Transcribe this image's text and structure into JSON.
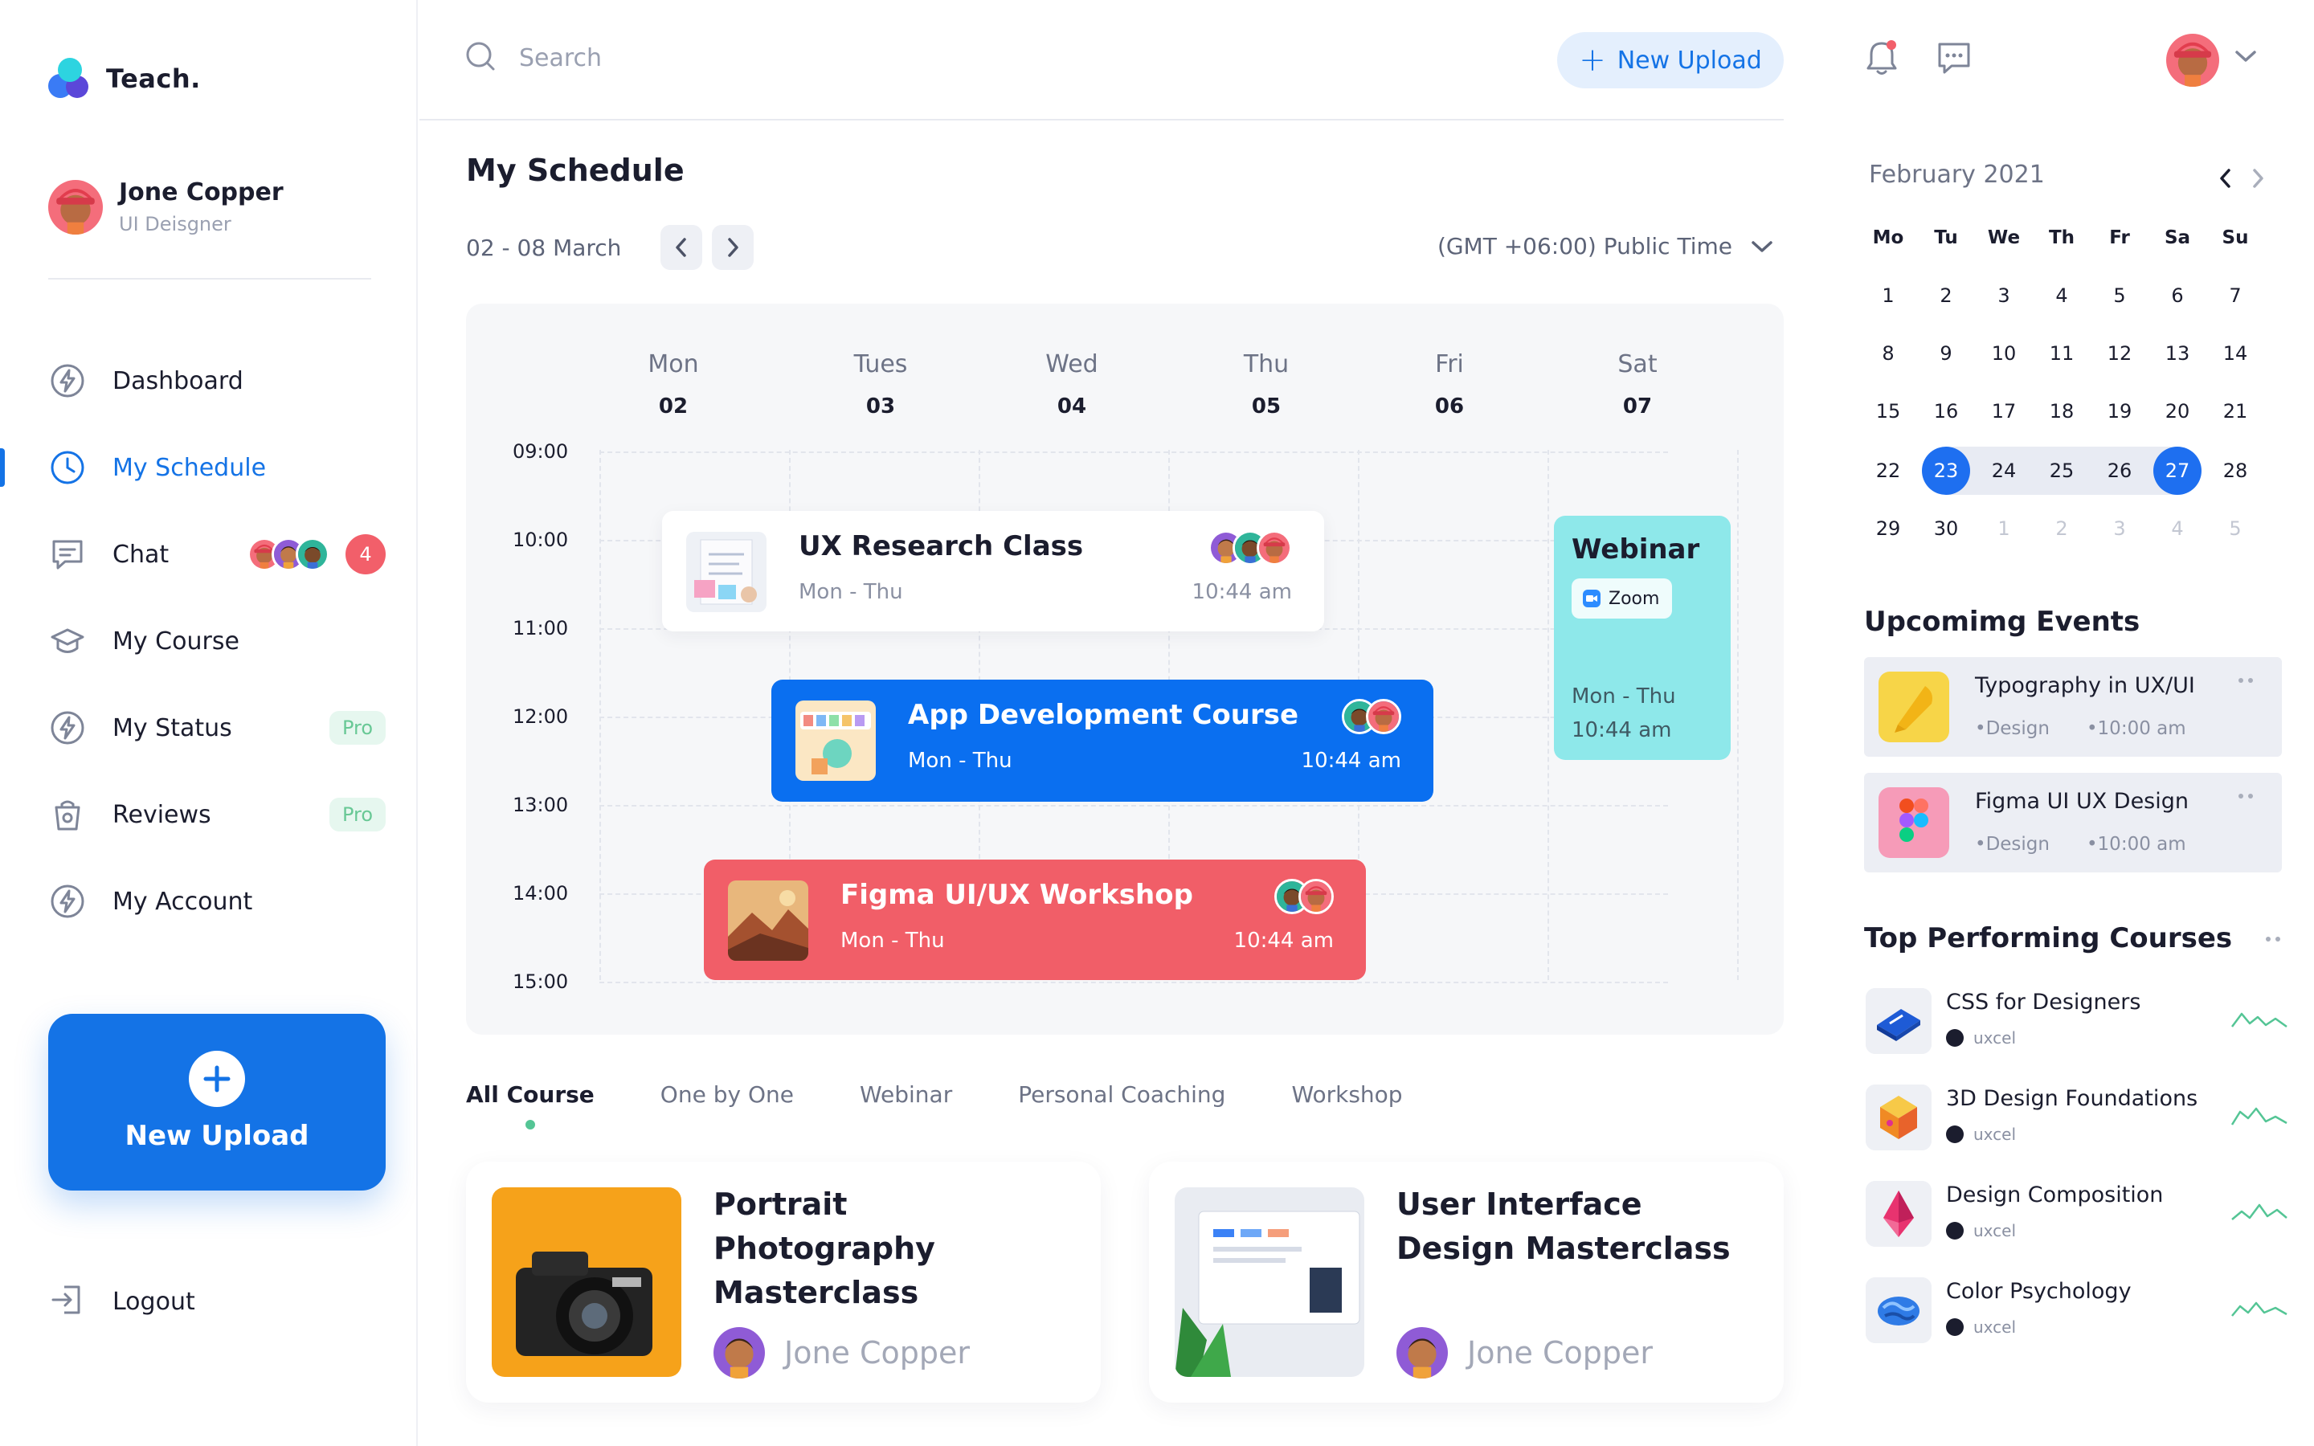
{
  "app": {
    "name": "Teach."
  },
  "colors": {
    "primary": "#1473e6",
    "accent_red": "#f15e68",
    "accent_cyan": "#8ee8ea",
    "success": "#54c595"
  },
  "user": {
    "name": "Jone Copper",
    "role": "UI Deisgner"
  },
  "sidebar": {
    "items": [
      {
        "label": "Dashboard",
        "icon": "lightning-icon"
      },
      {
        "label": "My Schedule",
        "icon": "clock-icon",
        "active": true
      },
      {
        "label": "Chat",
        "icon": "chat-icon",
        "badge": "4"
      },
      {
        "label": "My Course",
        "icon": "graduation-cap-icon"
      },
      {
        "label": "My Status",
        "icon": "lightning-icon",
        "pro": "Pro"
      },
      {
        "label": "Reviews",
        "icon": "bag-icon",
        "pro": "Pro"
      },
      {
        "label": "My Account",
        "icon": "lightning-icon"
      }
    ],
    "new_upload": "New Upload",
    "logout": "Logout"
  },
  "topbar": {
    "search_placeholder": "Search",
    "new_upload": "New Upload"
  },
  "schedule": {
    "title": "My Schedule",
    "week_range": "02 - 08 March",
    "timezone": "(GMT +06:00) Public Time",
    "days": [
      {
        "name": "Mon",
        "date": "02"
      },
      {
        "name": "Tues",
        "date": "03"
      },
      {
        "name": "Wed",
        "date": "04"
      },
      {
        "name": "Thu",
        "date": "05"
      },
      {
        "name": "Fri",
        "date": "06"
      },
      {
        "name": "Sat",
        "date": "07"
      }
    ],
    "times": [
      "09:00",
      "10:00",
      "11:00",
      "12:00",
      "13:00",
      "14:00",
      "15:00"
    ],
    "events": [
      {
        "title": "UX Research Class",
        "days": "Mon - Thu",
        "time": "10:44 am"
      },
      {
        "title": "App Development Course",
        "days": "Mon - Thu",
        "time": "10:44 am"
      },
      {
        "title": "Figma UI/UX Workshop",
        "days": "Mon - Thu",
        "time": "10:44 am"
      }
    ],
    "webinar": {
      "title": "Webinar",
      "platform": "Zoom",
      "days": "Mon - Thu",
      "time": "10:44 am"
    }
  },
  "course_tabs": [
    "All Course",
    "One by One",
    "Webinar",
    "Personal Coaching",
    "Workshop"
  ],
  "courses": [
    {
      "title": "Portrait Photography Masterclass",
      "author": "Jone Copper"
    },
    {
      "title": "User Interface Design Masterclass",
      "author": "Jone Copper"
    }
  ],
  "calendar": {
    "title": "February 2021",
    "weekdays": [
      "Mo",
      "Tu",
      "We",
      "Th",
      "Fr",
      "Sa",
      "Su"
    ],
    "weeks": [
      [
        "1",
        "2",
        "3",
        "4",
        "5",
        "6",
        "7"
      ],
      [
        "8",
        "9",
        "10",
        "11",
        "12",
        "13",
        "14"
      ],
      [
        "15",
        "16",
        "17",
        "18",
        "19",
        "20",
        "21"
      ],
      [
        "22",
        "23",
        "24",
        "25",
        "26",
        "27",
        "28"
      ],
      [
        "29",
        "30",
        "1",
        "2",
        "3",
        "4",
        "5"
      ]
    ],
    "selected_range": [
      "23",
      "27"
    ]
  },
  "upcoming": {
    "title": "Upcomimg Events",
    "items": [
      {
        "title": "Typography in UX/UI",
        "tag": "•Design",
        "time": "•10:00 am"
      },
      {
        "title": "Figma UI UX Design",
        "tag": "•Design",
        "time": "•10:00 am"
      }
    ]
  },
  "top_courses": {
    "title": "Top Performing Courses",
    "items": [
      {
        "title": "CSS for Designers",
        "provider": "uxcel"
      },
      {
        "title": "3D Design Foundations",
        "provider": "uxcel"
      },
      {
        "title": "Design Composition",
        "provider": "uxcel"
      },
      {
        "title": "Color Psychology",
        "provider": "uxcel"
      }
    ]
  }
}
